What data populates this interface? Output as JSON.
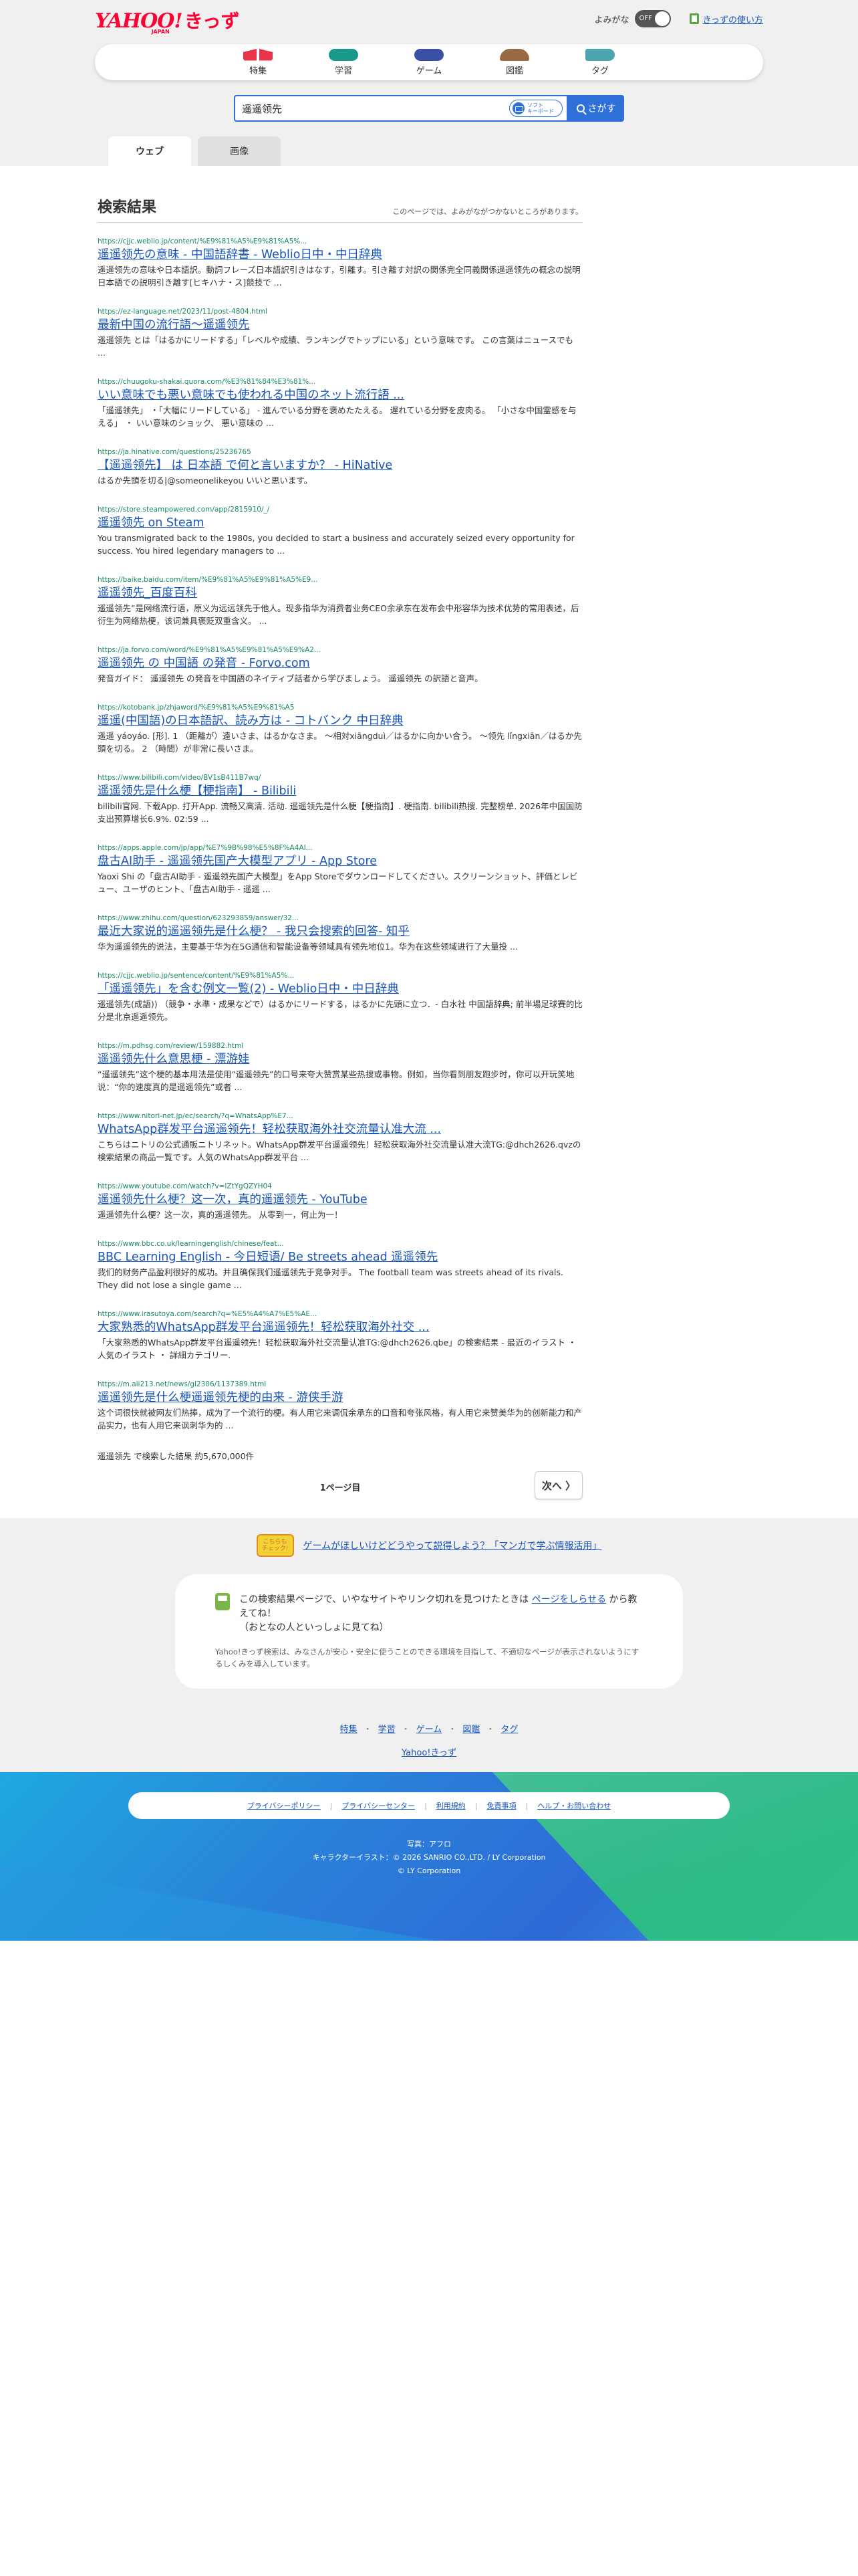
{
  "brand": {
    "logo_main": "YAHOO!",
    "logo_sub": "JAPAN",
    "logo_kids": "きっず"
  },
  "topbar": {
    "yomigana_label": "よみがな",
    "toggle_state": "OFF",
    "howto_link": "きっずの使い方"
  },
  "nav": [
    {
      "label": "特集",
      "icon": "tokushu-icon"
    },
    {
      "label": "学習",
      "icon": "gakushu-icon"
    },
    {
      "label": "ゲーム",
      "icon": "game-icon"
    },
    {
      "label": "図鑑",
      "icon": "zukan-icon"
    },
    {
      "label": "タグ",
      "icon": "tag-icon"
    }
  ],
  "search": {
    "query": "遥遥领先",
    "keyboard_line1": "ソフト",
    "keyboard_line2": "キーボード",
    "button_label": "さがす"
  },
  "tabs": [
    {
      "label": "ウェブ",
      "active": true
    },
    {
      "label": "画像",
      "active": false
    }
  ],
  "results_header": {
    "title": "検索結果",
    "note": "このページでは、よみがながつかないところがあります。"
  },
  "results": [
    {
      "url": "https://cjjc.weblio.jp/content/%E9%81%A5%E9%81%A5%...",
      "title": "遥遥领先の意味 - 中国語辞書 - Weblio日中・中日辞典",
      "snippet": "遥遥领先の意味や日本語訳。動詞フレーズ日本語訳引きはなす，引離す。引き離す対訳の関係完全同義関係遥遥领先の概念の説明日本語での説明引き離す[ヒキハナ・ス]競技で ..."
    },
    {
      "url": "https://ez-language.net/2023/11/post-4804.html",
      "title": "最新中国の流行語〜遥遥领先",
      "snippet": "遥遥领先 とは「はるかにリードする」「レベルや成績、ランキングでトップにいる」という意味です。 この言葉はニュースでも ..."
    },
    {
      "url": "https://chuugoku-shakai.quora.com/%E3%81%84%E3%81%...",
      "title": "いい意味でも悪い意味でも使われる中国のネット流行語 ...",
      "snippet": "「遥遥领先」 ・「大幅にリードしている」 - 進んでいる分野を褒めたたえる。 遅れている分野を皮肉る。 「小さな中国霊感を与える」 ・ いい意味のショック、 悪い意味の ..."
    },
    {
      "url": "https://ja.hinative.com/questions/25236765",
      "title": "【遥遥领先】 は 日本語 で何と言いますか？ - HiNative",
      "snippet": "はるか先頭を切る|@someonelikeyou いいと思います。"
    },
    {
      "url": "https://store.steampowered.com/app/2815910/_/",
      "title": "遥遥领先 on Steam",
      "snippet": "You transmigrated back to the 1980s, you decided to start a business and accurately seized every opportunity for success. You hired legendary managers to ..."
    },
    {
      "url": "https://baike.baidu.com/item/%E9%81%A5%E9%81%A5%E9...",
      "title": "遥遥领先_百度百科",
      "snippet": "遥遥领先”是网络流行语，原义为远远领先于他人。现多指华为消费者业务CEO余承东在发布会中形容华为技术优势的常用表述，后衍生为网络热梗，该词兼具褒贬双重含义。 ..."
    },
    {
      "url": "https://ja.forvo.com/word/%E9%81%A5%E9%81%A5%E9%A2...",
      "title": "遥遥领先 の 中国語 の発音 - Forvo.com",
      "snippet": "発音ガイド： 遥遥领先 の発音を中国語のネイティブ話者から学びましょう。 遥遥领先 の訳語と音声。"
    },
    {
      "url": "https://kotobank.jp/zhjaword/%E9%81%A5%E9%81%A5",
      "title": "遥遥(中国語)の日本語訳、読み方は - コトバンク 中日辞典",
      "snippet": "遥遥 yáoyáo. [形]. 1 （距離が）遠いさま、はるかなさま。 〜相対xiāngduì／はるかに向かい合う。 〜领先 lǐngxiān／はるか先頭を切る。 2 （時間）が非常に長いさま。"
    },
    {
      "url": "https://www.bilibili.com/video/BV1sB411B7wq/",
      "title": "遥遥领先是什么梗【梗指南】 - Bilibili",
      "snippet": "bilibili官网. 下载App. 打开App. 流畅又高清. 活动. 遥遥领先是什么梗【梗指南】. 梗指南. bilibili热搜. 完整榜单. 2026年中国国防支出预算增长6.9%. 02:59 ..."
    },
    {
      "url": "https://apps.apple.com/jp/app/%E7%9B%98%E5%8F%A4AI...",
      "title": "盘古AI助手 - 遥遥领先国产大模型アプリ - App Store",
      "snippet": "Yaoxi Shi の「盘古AI助手 - 遥遥领先国产大模型」をApp Storeでダウンロードしてください。スクリーンショット、評価とレビュー、ユーザのヒント、「盘古AI助手 - 遥遥 ..."
    },
    {
      "url": "https://www.zhihu.com/question/623293859/answer/32...",
      "title": "最近大家说的遥遥领先是什么梗？ - 我只会搜索的回答- 知乎",
      "snippet": "华为遥遥领先的说法，主要基于华为在5G通信和智能设备等领域具有领先地位1。华为在这些领域进行了大量投 ..."
    },
    {
      "url": "https://cjjc.weblio.jp/sentence/content/%E9%81%A5%...",
      "title": "「遥遥领先」を含む例文一覧(2) - Weblio日中・中日辞典",
      "snippet": "遥遥领先(成語)) （競争・水準・成果などで）はるかにリードする，はるかに先頭に立つ．- 白水社 中国語辞典; 前半場足球賽的比分是北京遥遥领先。"
    },
    {
      "url": "https://m.pdhsg.com/review/159882.html",
      "title": "遥遥领先什么意思梗 - 漂游娃",
      "snippet": "“遥遥领先”这个梗的基本用法是使用“遥遥领先”的口号来夸大赞赏某些热搜或事物。例如，当你看到朋友跑步时，你可以开玩笑地说：“你的速度真的是遥遥领先”或者 ..."
    },
    {
      "url": "https://www.nitori-net.jp/ec/search/?q=WhatsApp%E7...",
      "title": "WhatsApp群发平台遥遥领先！轻松获取海外社交流量认准大流 ...",
      "snippet": "こちらはニトリの公式通販ニトリネット。WhatsApp群发平台遥遥领先！轻松获取海外社交流量认准大流TG:@dhch2626.qvzの検索結果の商品一覧です。人気のWhatsApp群发平台 ..."
    },
    {
      "url": "https://www.youtube.com/watch?v=lZtYgQZYH04",
      "title": "遥遥领先什么梗？这一次，真的遥遥领先 - YouTube",
      "snippet": "遥遥领先什么梗？这一次，真的遥遥领先。 从零到一，何止为一！"
    },
    {
      "url": "https://www.bbc.co.uk/learningenglish/chinese/feat...",
      "title": "BBC Learning English - 今日短语/ Be streets ahead 遥遥领先",
      "snippet": "我们的财务产品盈利很好的成功。并且确保我们遥遥领先于竞争对手。 The football team was streets ahead of its rivals. They did not lose a single game ..."
    },
    {
      "url": "https://www.irasutoya.com/search?q=%E5%A4%A7%E5%AE...",
      "title": "大家熟悉的WhatsApp群发平台遥遥领先！轻松获取海外社交 ...",
      "snippet": "「大家熟悉的WhatsApp群发平台遥遥领先！轻松获取海外社交流量认准TG:@dhch2626.qbe」の検索結果 - 最近のイラスト ・ 人気のイラスト ・ 詳細カテゴリー."
    },
    {
      "url": "https://m.ali213.net/news/gl2306/1137389.html",
      "title": "遥遥领先是什么梗遥遥领先梗的由来 - 游侠手游",
      "snippet": "这个词很快就被网友们热捧，成为了一个流行的梗。有人用它来调侃余承东的口音和夸张风格，有人用它来赞美华为的创新能力和产品实力，也有人用它来讽刺华为的 ..."
    }
  ],
  "summary": {
    "total_text": "遥遥领先 で検索した結果 約5,670,000件"
  },
  "pager": {
    "page_label": "1ページ目",
    "next_label": "次へ 〉"
  },
  "promo": {
    "badge_line1": "こちらも",
    "badge_line2": "チェック!",
    "link": "ゲームがほしいけどどうやって説得しよう？「マンガで学ぶ情報活用」"
  },
  "report": {
    "line1_before": "この検索結果ページで、いやなサイトやリンク切れを見つけたときは",
    "line1_link": "ページをしらせる",
    "line1_after": "から教えてね！",
    "line2": "（おとなの人といっしょに見てね）",
    "small": "Yahoo!きっず検索は、みなさんが安心・安全に使うことのできる環境を目指して、不適切なページが表示されないようにするしくみを導入しています。"
  },
  "footer": {
    "links": [
      "特集",
      "学習",
      "ゲーム",
      "図鑑",
      "タグ"
    ],
    "home": "Yahoo!きっず",
    "legal": [
      "プライバシーポリシー",
      "プライバシーセンター",
      "利用規約",
      "免責事項",
      "ヘルプ・お問い合わせ"
    ],
    "photo_credit": "写真：アフロ",
    "character_credit": "キャラクターイラスト：© 2026 SANRIO CO.,LTD. / LY Corporation",
    "copyright": "© LY Corporation"
  },
  "colors": {
    "link": "#1a55b8",
    "url_green": "#198a5f",
    "search_blue": "#2f6fd8",
    "brand_red": "#ff0033"
  }
}
